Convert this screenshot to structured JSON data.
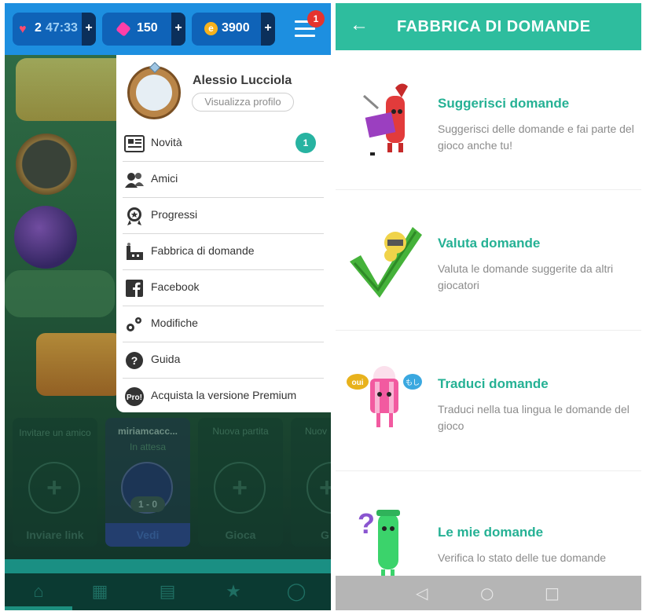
{
  "status": {
    "lives": "2",
    "timer": "47:33",
    "tickets": "150",
    "coins": "3900",
    "plus": "+",
    "notification_count": "1"
  },
  "menu": {
    "profile_name": "Alessio Lucciola",
    "profile_button": "Visualizza profilo",
    "items": [
      {
        "label": "Novità",
        "icon": "newspaper-icon",
        "count": "1"
      },
      {
        "label": "Amici",
        "icon": "friends-icon"
      },
      {
        "label": "Progressi",
        "icon": "medal-icon"
      },
      {
        "label": "Fabbrica di domande",
        "icon": "factory-icon"
      },
      {
        "label": "Facebook",
        "icon": "facebook-icon"
      },
      {
        "label": "Modifiche",
        "icon": "gears-icon"
      },
      {
        "label": "Guida",
        "icon": "help-icon"
      },
      {
        "label": "Acquista la versione Premium",
        "icon": "pro-icon"
      }
    ],
    "pro_badge": "Pro!",
    "help_symbol": "?"
  },
  "games": [
    {
      "title": "Invitare un amico",
      "subtitle": "",
      "action": "Inviare link"
    },
    {
      "title": "miriamcacc...",
      "subtitle": "In attesa",
      "score": "1 - 0",
      "action": "Vedi"
    },
    {
      "title": "Nuova partita",
      "subtitle": "",
      "action": "Gioca"
    },
    {
      "title": "Nuov",
      "subtitle": "",
      "action": "G"
    }
  ],
  "right": {
    "title": "FABBRICA DI DOMANDE",
    "cards": [
      {
        "title": "Suggerisci domande",
        "desc": "Suggerisci delle domande e fai parte del gioco anche tu!"
      },
      {
        "title": "Valuta domande",
        "desc": "Valuta le domande suggerite da altri giocatori"
      },
      {
        "title": "Traduci domande",
        "desc": "Traduci nella tua lingua le domande del gioco",
        "bubble_left": "oui",
        "bubble_right": "もし"
      },
      {
        "title": "Le mie domande",
        "desc": "Verifica lo stato delle tue domande"
      }
    ]
  },
  "colors": {
    "accent": "#2ebd9e",
    "topbar": "#1d8fe0",
    "badge": "#e5342e"
  }
}
